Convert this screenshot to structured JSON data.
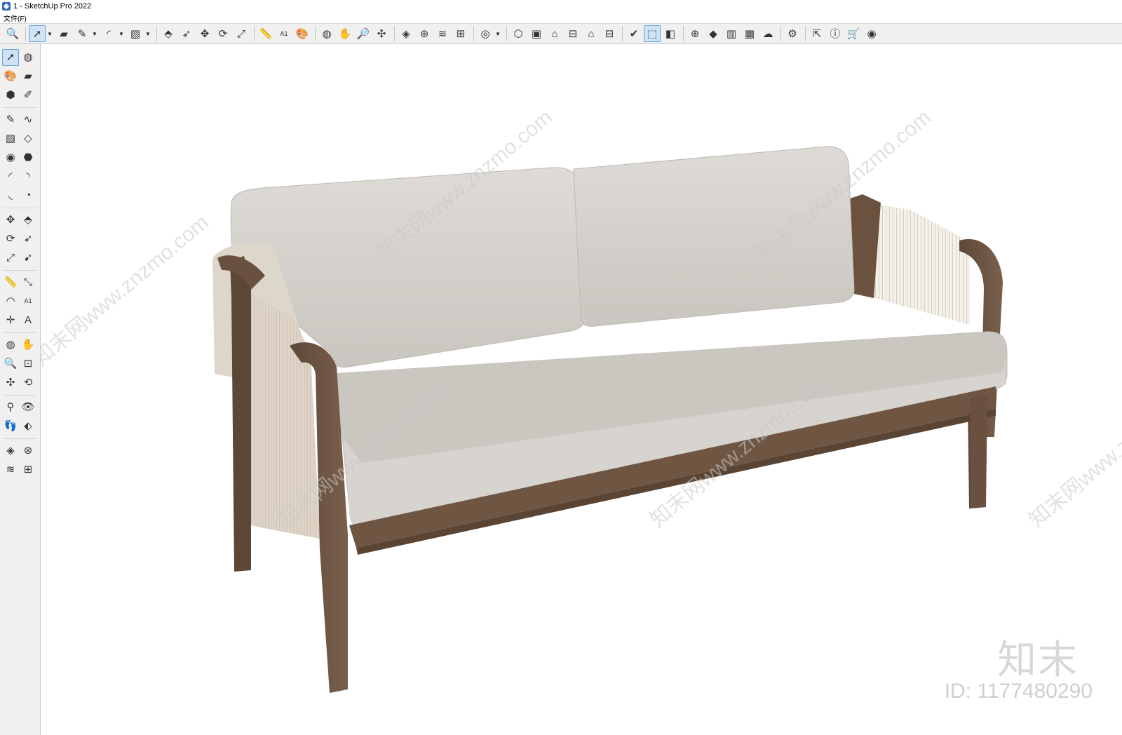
{
  "window": {
    "title": "1 - SketchUp Pro 2022"
  },
  "menu": {
    "items": [
      "文件(F)"
    ]
  },
  "toolbar_top": {
    "groups": [
      [
        {
          "name": "zoom-icon",
          "glyph": "🔍"
        }
      ],
      [
        {
          "name": "select-icon",
          "glyph": "➚",
          "active": true,
          "dropdown": true
        },
        {
          "name": "eraser-icon",
          "glyph": "▰"
        },
        {
          "name": "line-icon",
          "glyph": "✎",
          "dropdown": true
        },
        {
          "name": "arc-icon",
          "glyph": "◜",
          "dropdown": true
        },
        {
          "name": "rectangle-icon",
          "glyph": "▧",
          "dropdown": true
        }
      ],
      [
        {
          "name": "push-pull-icon",
          "glyph": "⬘"
        },
        {
          "name": "follow-me-icon",
          "glyph": "➶"
        },
        {
          "name": "move-icon",
          "glyph": "✥"
        },
        {
          "name": "rotate-icon",
          "glyph": "⟳"
        },
        {
          "name": "scale-icon",
          "glyph": "⤢"
        }
      ],
      [
        {
          "name": "tape-measure-icon",
          "glyph": "📏"
        },
        {
          "name": "text-icon",
          "glyph": "A1"
        },
        {
          "name": "paint-bucket-icon",
          "glyph": "🎨"
        }
      ],
      [
        {
          "name": "orbit-icon",
          "glyph": "◍"
        },
        {
          "name": "pan-icon",
          "glyph": "✋"
        },
        {
          "name": "zoom-tool-icon",
          "glyph": "🔎"
        },
        {
          "name": "zoom-extents-icon",
          "glyph": "✣"
        }
      ],
      [
        {
          "name": "warehouse-icon",
          "glyph": "◈"
        },
        {
          "name": "extension-icon",
          "glyph": "⊛"
        },
        {
          "name": "layers-icon",
          "glyph": "≋"
        },
        {
          "name": "sandbox-icon",
          "glyph": "⊞"
        }
      ],
      [
        {
          "name": "user-icon",
          "glyph": "◎",
          "dropdown": true
        }
      ],
      [
        {
          "name": "iso-view-icon",
          "glyph": "⬡"
        },
        {
          "name": "front-view-icon",
          "glyph": "▣"
        },
        {
          "name": "top-view-icon",
          "glyph": "⌂"
        },
        {
          "name": "right-view-icon",
          "glyph": "⊟"
        },
        {
          "name": "back-view-icon",
          "glyph": "⌂"
        },
        {
          "name": "left-view-icon",
          "glyph": "⊟"
        }
      ],
      [
        {
          "name": "check-icon",
          "glyph": "✔"
        },
        {
          "name": "section-icon",
          "glyph": "⬚",
          "active": true
        },
        {
          "name": "camera-icon",
          "glyph": "◧"
        }
      ],
      [
        {
          "name": "add-location-icon",
          "glyph": "⊕"
        },
        {
          "name": "shadow-icon",
          "glyph": "◆"
        },
        {
          "name": "building-icon",
          "glyph": "▥"
        },
        {
          "name": "checker-icon",
          "glyph": "▦"
        },
        {
          "name": "cloud-icon",
          "glyph": "☁"
        }
      ],
      [
        {
          "name": "settings-icon",
          "glyph": "⚙"
        }
      ],
      [
        {
          "name": "export-icon",
          "glyph": "⇱"
        },
        {
          "name": "info-icon",
          "glyph": "ⓘ"
        },
        {
          "name": "cart-icon",
          "glyph": "🛒"
        },
        {
          "name": "account-icon",
          "glyph": "◉"
        }
      ]
    ]
  },
  "toolbar_left": {
    "groups": [
      [
        [
          "select-icon",
          "➚",
          true
        ],
        [
          "orbit-icon",
          "◍",
          false
        ]
      ],
      [
        [
          "paint-bucket-icon",
          "🎨",
          false
        ],
        [
          "eraser-icon",
          "▰",
          false
        ]
      ],
      [
        [
          "component-icon",
          "⬢",
          false
        ],
        [
          "tag-icon",
          "✐",
          false
        ]
      ],
      null,
      [
        [
          "line-icon",
          "✎",
          false
        ],
        [
          "freehand-icon",
          "∿",
          false
        ]
      ],
      [
        [
          "rectangle-icon",
          "▧",
          false
        ],
        [
          "rotated-rectangle-icon",
          "◇",
          false
        ]
      ],
      [
        [
          "circle-icon",
          "◉",
          false
        ],
        [
          "polygon-icon",
          "⬣",
          false
        ]
      ],
      [
        [
          "arc-icon",
          "◜",
          false
        ],
        [
          "two-point-arc-icon",
          "◝",
          false
        ]
      ],
      [
        [
          "three-point-arc-icon",
          "◟",
          false
        ],
        [
          "pie-icon",
          "◔",
          false
        ]
      ],
      null,
      [
        [
          "move-icon",
          "✥",
          false
        ],
        [
          "push-pull-icon",
          "⬘",
          false
        ]
      ],
      [
        [
          "rotate-icon",
          "⟳",
          false
        ],
        [
          "follow-me-icon",
          "➶",
          false
        ]
      ],
      [
        [
          "scale-icon",
          "⤢",
          false
        ],
        [
          "offset-icon",
          "➹",
          false
        ]
      ],
      null,
      [
        [
          "tape-measure-icon",
          "📏",
          false
        ],
        [
          "dimension-icon",
          "⤡",
          false
        ]
      ],
      [
        [
          "protractor-icon",
          "◠",
          false
        ],
        [
          "text-icon",
          "A1",
          false
        ]
      ],
      [
        [
          "axes-icon",
          "✛",
          false
        ],
        [
          "3d-text-icon",
          "A",
          false
        ]
      ],
      null,
      [
        [
          "orbit-tool-icon",
          "◍",
          false
        ],
        [
          "pan-icon",
          "✋",
          false
        ]
      ],
      [
        [
          "zoom-icon",
          "🔍",
          false
        ],
        [
          "zoom-window-icon",
          "⊡",
          false
        ]
      ],
      [
        [
          "zoom-extents-icon",
          "✣",
          false
        ],
        [
          "previous-view-icon",
          "⟲",
          false
        ]
      ],
      null,
      [
        [
          "position-camera-icon",
          "⚲",
          false
        ],
        [
          "look-around-icon",
          "👁",
          false
        ]
      ],
      [
        [
          "walk-icon",
          "👣",
          false
        ],
        [
          "section-plane-icon",
          "⬖",
          false
        ]
      ],
      null,
      [
        [
          "warehouse-icon",
          "◈",
          false
        ],
        [
          "extension-icon",
          "⊛",
          false
        ]
      ],
      [
        [
          "layers-icon",
          "≋",
          false
        ],
        [
          "sandbox-icon",
          "⊞",
          false
        ]
      ]
    ]
  },
  "viewport": {
    "watermark_text": "知末网www.znzmo.com",
    "brand_logo": "知末",
    "brand_id": "ID: 1177480290"
  },
  "colors": {
    "wood": "#6e5542",
    "wood_dark": "#5a4434",
    "cushion": "#d9d6d1",
    "cushion_shadow": "#c4c1bb",
    "rope": "#d6cdbf"
  }
}
